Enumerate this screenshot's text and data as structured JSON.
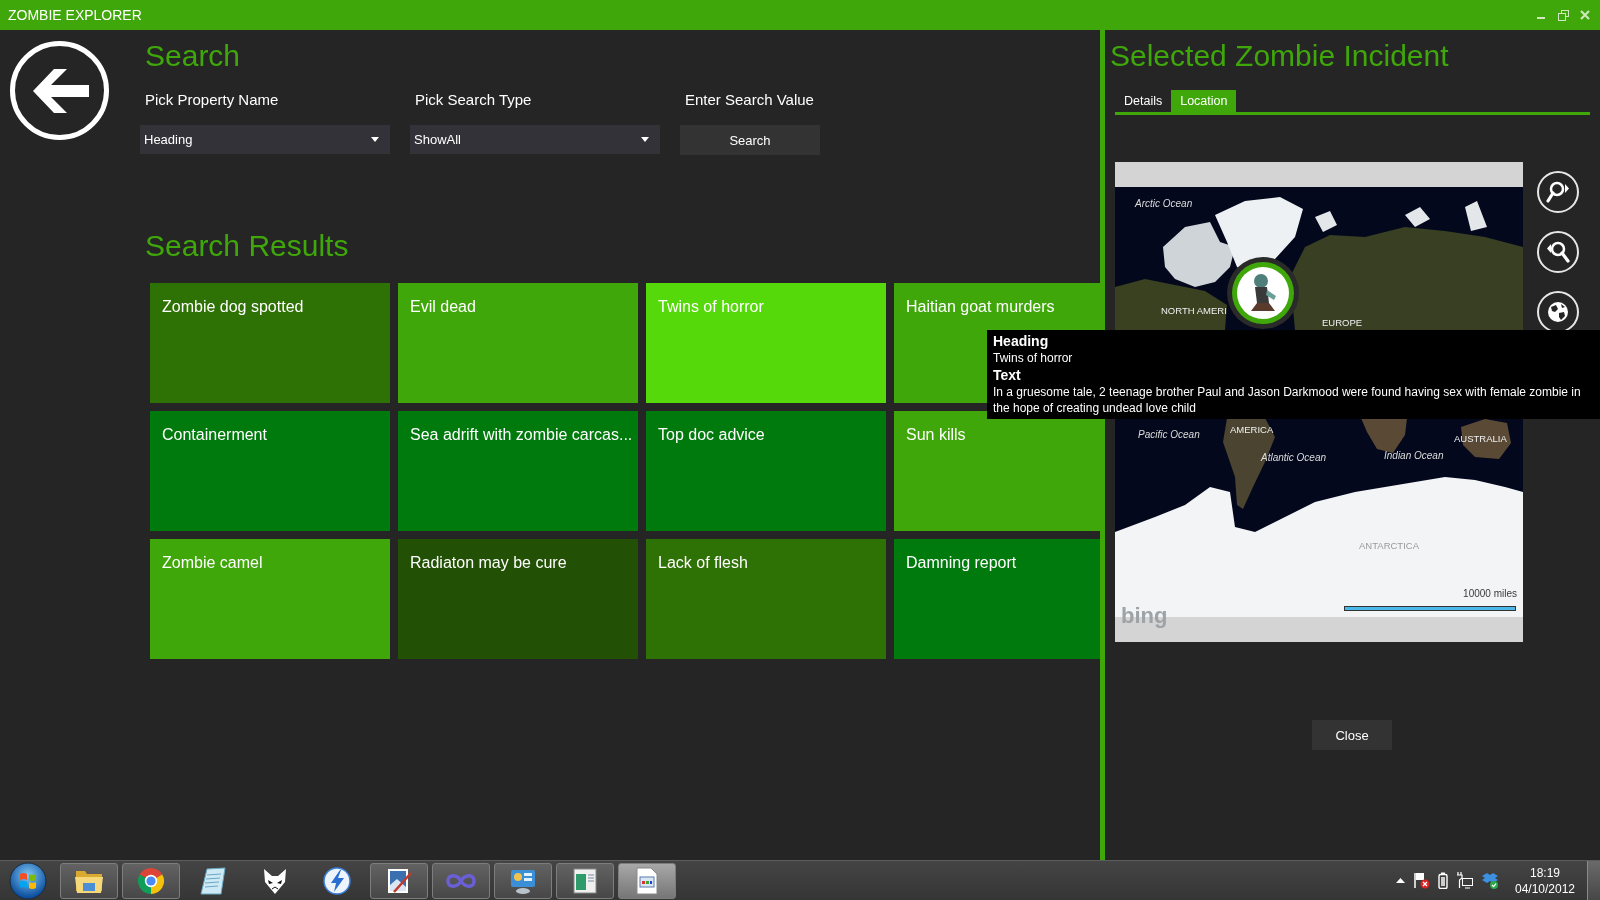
{
  "window": {
    "title": "ZOMBIE EXPLORER"
  },
  "search": {
    "heading": "Search",
    "fields": [
      {
        "kind": "dropdown",
        "label": "Pick Property Name",
        "value": "Heading"
      },
      {
        "kind": "dropdown",
        "label": "Pick Search Type",
        "value": "ShowAll"
      },
      {
        "kind": "button",
        "label": "Enter Search Value",
        "value": "Search"
      }
    ]
  },
  "results": {
    "heading": "Search Results",
    "tiles": [
      {
        "title": "Zombie dog spotted",
        "color": "#2e7104"
      },
      {
        "title": "Evil dead",
        "color": "#3fa70a"
      },
      {
        "title": "Twins of horror",
        "color": "#55d90b"
      },
      {
        "title": "Haitian goat murders",
        "color": "#3fa70a"
      },
      {
        "title": "Containerment",
        "color": "#007a0c"
      },
      {
        "title": "Sea adrift with zombie carcas...",
        "color": "#007a0c"
      },
      {
        "title": "Top doc advice",
        "color": "#007a0c"
      },
      {
        "title": "Sun kills",
        "color": "#3fa70a"
      },
      {
        "title": "Zombie camel",
        "color": "#3fa70a"
      },
      {
        "title": "Radiaton may be cure",
        "color": "#225004"
      },
      {
        "title": "Lack of flesh",
        "color": "#2e7104"
      },
      {
        "title": "Damning report",
        "color": "#007a0c"
      }
    ]
  },
  "incident": {
    "heading": "Selected Zombie Incident",
    "tabs": [
      {
        "label": "Details",
        "selected": false
      },
      {
        "label": "Location",
        "selected": true
      }
    ],
    "map": {
      "labels": [
        {
          "kind": "ocean",
          "text": "Arctic Ocean"
        },
        {
          "kind": "continent",
          "text": "NORTH AMERI"
        },
        {
          "kind": "continent",
          "text": "EUROPE"
        },
        {
          "kind": "continent",
          "text": "AMERICA"
        },
        {
          "kind": "ocean",
          "text": "Pacific Ocean"
        },
        {
          "kind": "ocean",
          "text": "Atlantic Ocean"
        },
        {
          "kind": "ocean",
          "text": "Indian Ocean"
        },
        {
          "kind": "continent",
          "text": "AUSTRALIA"
        },
        {
          "kind": "polar",
          "text": "ANTARCTICA"
        }
      ],
      "scale": "10000 miles",
      "logo": "bing"
    },
    "close_button": "Close"
  },
  "tooltip": {
    "fields": [
      {
        "label": "Heading",
        "value": "Twins of horror"
      },
      {
        "label": "Text",
        "value": "In a gruesome tale, 2 teenage brother Paul and Jason Darkmood were found having sex with female zombie in the hope of creating undead love child"
      }
    ]
  },
  "taskbar": {
    "apps": [
      {
        "running": true,
        "active": false
      },
      {
        "running": true,
        "active": false
      },
      {
        "running": false,
        "active": false
      },
      {
        "running": false,
        "active": false
      },
      {
        "running": false,
        "active": false
      },
      {
        "running": true,
        "active": false
      },
      {
        "running": true,
        "active": false
      },
      {
        "running": true,
        "active": false
      },
      {
        "running": true,
        "active": false
      },
      {
        "running": true,
        "active": true
      }
    ],
    "clock": {
      "time": "18:19",
      "date": "04/10/2012"
    }
  }
}
